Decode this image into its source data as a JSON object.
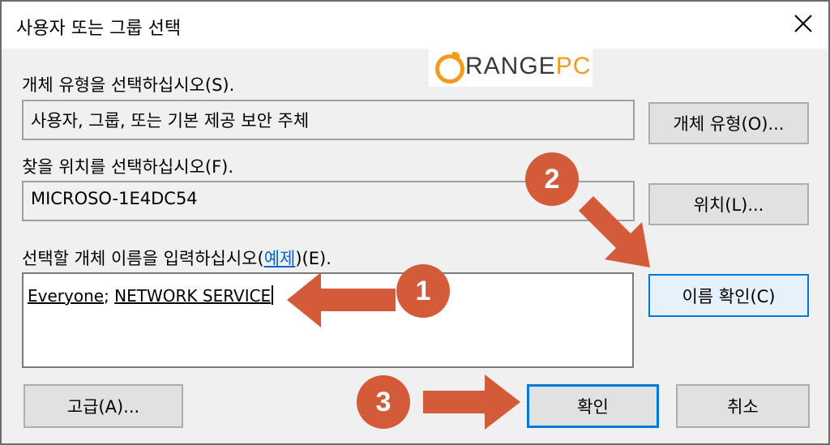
{
  "window": {
    "title": "사용자 또는 그룹 선택",
    "close_icon": "close-icon"
  },
  "logo": {
    "text_main": "RANGE",
    "text_accent": "PC",
    "text_initial": "O"
  },
  "object_type": {
    "label": "개체 유형을 선택하십시오(S).",
    "value": "사용자, 그룹, 또는 기본 제공 보안 주체",
    "button": "개체 유형(O)..."
  },
  "location": {
    "label": "찾을 위치를 선택하십시오(F).",
    "value": "MICROSO-1E4DC54",
    "button": "위치(L)..."
  },
  "names": {
    "label_prefix": "선택할 개체 이름을 입력하십시오(",
    "label_link": "예제",
    "label_suffix": ")(E).",
    "entry1": "Everyone",
    "separator": "; ",
    "entry2": "NETWORK SERVICE",
    "check_button": "이름 확인(C)"
  },
  "footer": {
    "advanced_button": "고급(A)...",
    "ok_button": "확인",
    "cancel_button": "취소"
  },
  "annotations": {
    "step1": "1",
    "step2": "2",
    "step3": "3"
  },
  "colors": {
    "accent": "#0078d7",
    "annotation": "#d35b3a",
    "logo": "#f39c1b"
  }
}
